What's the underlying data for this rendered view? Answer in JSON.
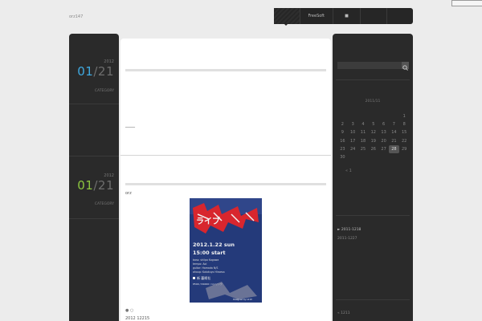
{
  "site": {
    "title": "orz147"
  },
  "nav": {
    "items": [
      "",
      "FreeSoft",
      "■",
      "",
      ""
    ]
  },
  "posts": [
    {
      "year": "2012",
      "month": "01",
      "day": "21",
      "category": "CATEGORY",
      "accent": "#3fa9e0",
      "title": "",
      "body": "────"
    },
    {
      "year": "2012",
      "month": "01",
      "day": "21",
      "category": "CATEGORY",
      "accent": "#8cc63f",
      "title": "",
      "body": "orz",
      "footer_marker": "● ○",
      "footer_date": "2012 12215"
    }
  ],
  "poster": {
    "title_art": "ライブ",
    "date_line": "2012.1.22 sun",
    "time_line": "15:00 start",
    "lineup": [
      "bass: shiipo  Kagawa",
      "tempo: Aoi",
      "guitar: Hamada  N/S",
      "ahoup: Kaiokuyo  Hiroesa"
    ],
    "venue": "新 藝術社",
    "price": "¥500 / ¥1000 / 1ドリンク",
    "footer_note": "Designed by 1210",
    "colors": {
      "background": "#243a7a",
      "accent": "#d8262e",
      "text": "#f2f2f2"
    }
  },
  "sidebar": {
    "search_placeholder": "",
    "search_button": "search-icon",
    "calendar": {
      "caption": "2011/11",
      "weeks": [
        [
          "",
          "",
          "",
          "",
          "",
          "",
          "1"
        ],
        [
          "2",
          "3",
          "4",
          "5",
          "6",
          "7",
          "8"
        ],
        [
          "9",
          "10",
          "11",
          "12",
          "13",
          "14",
          "15"
        ],
        [
          "16",
          "17",
          "18",
          "19",
          "20",
          "21",
          "22"
        ],
        [
          "23",
          "24",
          "25",
          "26",
          "27",
          "28",
          "29"
        ],
        [
          "30",
          "",
          "",
          "",
          "",
          "",
          ""
        ]
      ],
      "today": "28",
      "nav_label": "« 1"
    },
    "archives": [
      {
        "label": "► 2011-1218",
        "active": true
      },
      {
        "label": "2011-1227",
        "active": false
      }
    ],
    "footer_link": "« 1211"
  }
}
